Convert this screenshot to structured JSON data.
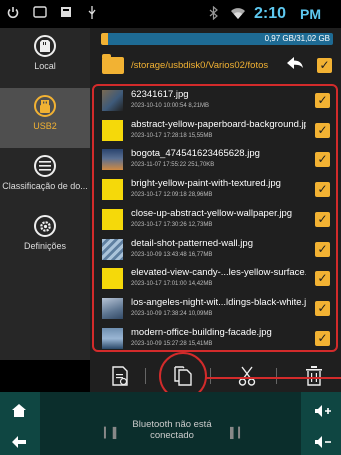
{
  "status_bar": {
    "time": "2:10",
    "ampm": "PM",
    "icons": [
      "power-icon",
      "window-icon",
      "square-icon",
      "usb-icon",
      "bluetooth-icon",
      "wifi-icon"
    ]
  },
  "sidebar": {
    "items": [
      {
        "label": "Local",
        "icon": "sd-card-icon",
        "active": false
      },
      {
        "label": "USB2",
        "icon": "usb-drive-icon",
        "active": true
      },
      {
        "label": "Classificação de do...",
        "icon": "list-icon",
        "active": false
      },
      {
        "label": "Definições",
        "icon": "gear-icon",
        "active": false
      }
    ]
  },
  "storage": {
    "text": "0,97 GB/31,02 GB",
    "used_fraction": 0.031
  },
  "path": {
    "text": "/storage/usbdisk0/Varios02/fotos"
  },
  "files": [
    {
      "name": "62341617.jpg",
      "meta": "2023-10-10 10:00:54  8,21MB",
      "thumb": "photo"
    },
    {
      "name": "abstract-yellow-paperboard-background.jpg",
      "meta": "2023-10-17 17:28:18  15,55MB",
      "thumb": "yellow"
    },
    {
      "name": "bogota_474541623465628.jpg",
      "meta": "2023-11-07 17:55:22  251,70KB",
      "thumb": "photo3"
    },
    {
      "name": "bright-yellow-paint-with-textured.jpg",
      "meta": "2023-10-17 12:09:18  28,96MB",
      "thumb": "yellow"
    },
    {
      "name": "close-up-abstract-yellow-wallpaper.jpg",
      "meta": "2023-10-17 17:30:26  12,73MB",
      "thumb": "yellow"
    },
    {
      "name": "detail-shot-patterned-wall.jpg",
      "meta": "2023-10-09 13:43:48  16,77MB",
      "thumb": "pattern"
    },
    {
      "name": "elevated-view-candy-...les-yellow-surface.jpg",
      "meta": "2023-10-17 17:01:00  14,42MB",
      "thumb": "yellow"
    },
    {
      "name": "los-angeles-night-wit...ldings-black-white.jpg",
      "meta": "2023-10-09 17:38:24  10,09MB",
      "thumb": "photo2"
    },
    {
      "name": "modern-office-building-facade.jpg",
      "meta": "2023-10-09 15:27:28  15,41MB",
      "thumb": "photo4"
    }
  ],
  "toolbar": {
    "items": [
      "file-info-icon",
      "copy-icon",
      "cut-icon",
      "delete-icon"
    ]
  },
  "bottom_bar": {
    "bluetooth_text_line1": "Bluetooth não está",
    "bluetooth_text_line2": "conectado"
  },
  "colors": {
    "accent": "#f2b233",
    "time": "#5ec8ef",
    "highlight": "#d32b2b",
    "storage_bar": "#1e6b94"
  }
}
